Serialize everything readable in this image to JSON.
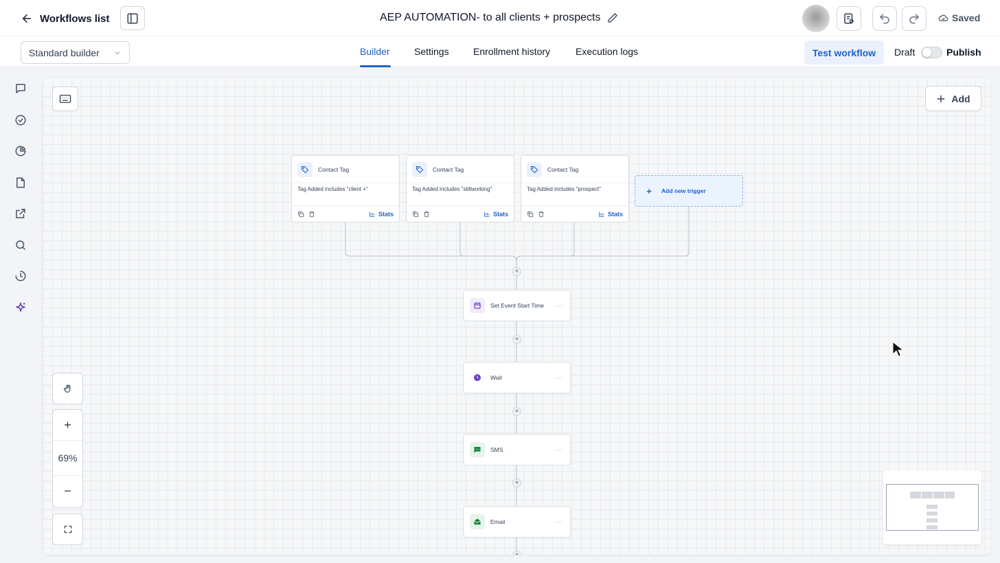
{
  "header": {
    "back_label": "Workflows list",
    "workflow_title": "AEP AUTOMATION- to all clients + prospects",
    "saved_label": "Saved"
  },
  "subbar": {
    "builder_mode": "Standard builder",
    "tabs": [
      {
        "label": "Builder",
        "active": true
      },
      {
        "label": "Settings",
        "active": false
      },
      {
        "label": "Enrollment history",
        "active": false
      },
      {
        "label": "Execution logs",
        "active": false
      }
    ],
    "test_workflow_label": "Test workflow",
    "draft_label": "Draft",
    "publish_label": "Publish",
    "published": false
  },
  "rail": {
    "icons": [
      "chat-icon",
      "check-circle-icon",
      "pie-chart-icon",
      "document-icon",
      "external-link-icon",
      "search-icon",
      "history-icon",
      "sparkle-icon"
    ]
  },
  "canvas": {
    "add_label": "Add",
    "triggers": [
      {
        "name": "Contact Tag",
        "condition": "Tag Added includes \"client +\"",
        "stats_label": "Stats"
      },
      {
        "name": "Contact Tag",
        "condition": "Tag Added includes \"stillworking\"",
        "stats_label": "Stats"
      },
      {
        "name": "Contact Tag",
        "condition": "Tag Added includes \"prospect\"",
        "stats_label": "Stats"
      }
    ],
    "add_trigger_label": "Add new trigger",
    "actions": [
      {
        "name": "Set Event Start Time",
        "icon": "calendar-icon",
        "color": "#6941c6"
      },
      {
        "name": "Wait",
        "icon": "clock-icon",
        "color": "#6941c6"
      },
      {
        "name": "SMS",
        "icon": "message-icon",
        "color": "#15803d"
      },
      {
        "name": "Email",
        "icon": "mail-icon",
        "color": "#15803d"
      }
    ],
    "zoom_level": "69%"
  },
  "colors": {
    "accent": "#1d63c9",
    "canvas_bg": "#f6f7f8"
  }
}
